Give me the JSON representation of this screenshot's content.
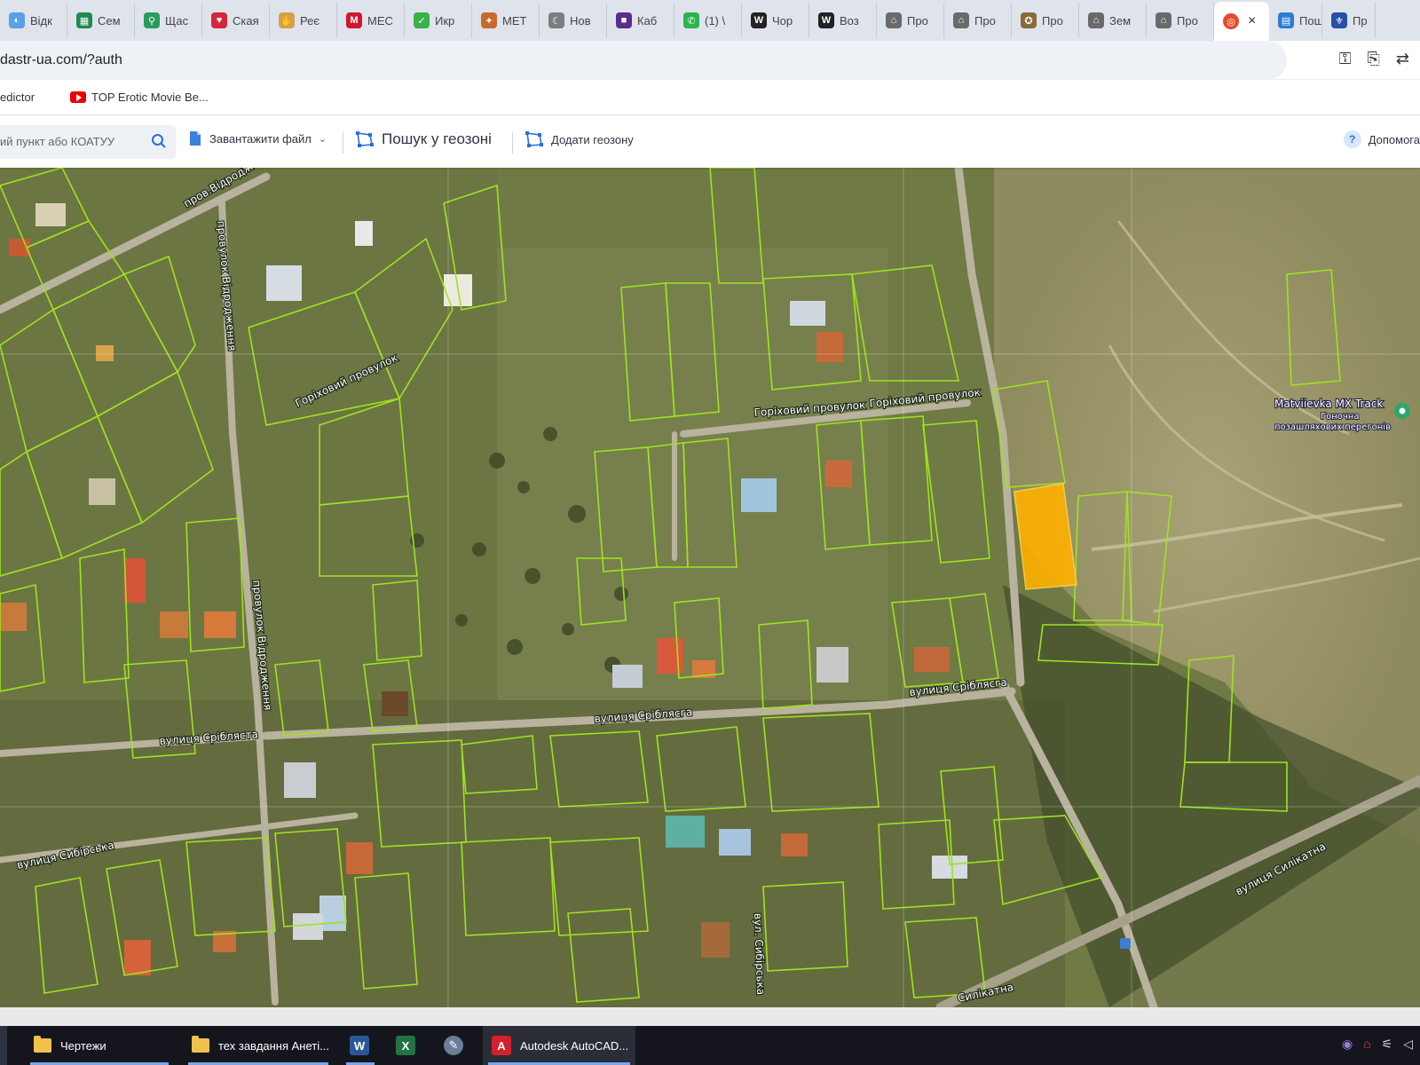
{
  "browser": {
    "tabs": [
      {
        "label": "Відк",
        "icon": "globe-icon",
        "color": "#5aa0e6"
      },
      {
        "label": "Сем",
        "icon": "sheets-icon",
        "color": "#1f8a4c"
      },
      {
        "label": "Щас",
        "icon": "map-pin-icon",
        "color": "#2a9d5b"
      },
      {
        "label": "Ская",
        "icon": "heart-icon",
        "color": "#d6263a"
      },
      {
        "label": "Реє",
        "icon": "hand-icon",
        "color": "#d4a14a"
      },
      {
        "label": "МЕС",
        "icon": "m-icon",
        "color": "#d0162c"
      },
      {
        "label": "Икр",
        "icon": "check-icon",
        "color": "#3cb04a"
      },
      {
        "label": "МЕТ",
        "icon": "compass-icon",
        "color": "#c8692b"
      },
      {
        "label": "Нов",
        "icon": "moon-icon",
        "color": "#7d7d7d"
      },
      {
        "label": "Каб",
        "icon": "square-icon",
        "color": "#5b2d8e"
      },
      {
        "label": "(1) \\",
        "icon": "whatsapp-icon",
        "color": "#2bb24c"
      },
      {
        "label": "Чор",
        "icon": "wikipedia-icon",
        "color": "#222222"
      },
      {
        "label": "Воз",
        "icon": "wikipedia-icon",
        "color": "#222222"
      },
      {
        "label": "Про",
        "icon": "building-icon",
        "color": "#6a6a6a"
      },
      {
        "label": "Про",
        "icon": "building-icon",
        "color": "#6a6a6a"
      },
      {
        "label": "Про",
        "icon": "badge-icon",
        "color": "#8a6a3a"
      },
      {
        "label": "Зем",
        "icon": "building-icon",
        "color": "#6a6a6a"
      },
      {
        "label": "Про",
        "icon": "building-icon",
        "color": "#6a6a6a"
      }
    ],
    "active_tab": {
      "icon": "kadastr-icon",
      "close": "×"
    },
    "after_tabs": [
      {
        "label": "Пош",
        "icon": "doc-icon"
      },
      {
        "label": "Пр",
        "icon": "emblem-icon"
      }
    ],
    "url": "dastr-ua.com/?auth",
    "bookmarks": [
      {
        "label": "edictor",
        "icon": ""
      },
      {
        "label": "TOP Erotic Movie Be...",
        "icon": "youtube-icon"
      }
    ]
  },
  "toolbar": {
    "search_placeholder": "ий пункт або КОАТУУ",
    "upload_label": "Завантажити файл",
    "geozone_search_label": "Пошук у геозоні",
    "add_geozone_label": "Додати геозону",
    "help_label": "Допомога"
  },
  "map": {
    "streets": [
      {
        "name": "пров.Відродж"
      },
      {
        "name": "провулок Відродження"
      },
      {
        "name": "Горіховий провулок"
      },
      {
        "name": "Горіховий провулок"
      },
      {
        "name": "Горіховий провулок"
      },
      {
        "name": "вулиця Сріблясга"
      },
      {
        "name": "вулиця Сріблясга"
      },
      {
        "name": "вулиця Срібляста"
      },
      {
        "name": "провулок Відродження"
      },
      {
        "name": "вулиця Сибірська"
      },
      {
        "name": "вул. Сибірська"
      },
      {
        "name": "вулиця Силікатна"
      },
      {
        "name": "Силікатна"
      }
    ],
    "poi": {
      "name": "Matviievka MX Track",
      "sub1": "Гоночна",
      "sub2": "позашляхових перегонів"
    },
    "colors": {
      "parcel_outline": "#9ee31e",
      "selected_parcel": "#ffb000",
      "road": "#b9b29e"
    }
  },
  "taskbar": {
    "items": [
      {
        "label": "Чертежи",
        "icon": "folder-icon"
      },
      {
        "label": "тех завдання Анеті...",
        "icon": "folder-icon"
      },
      {
        "label": "",
        "icon": "word-icon"
      },
      {
        "label": "",
        "icon": "excel-icon"
      },
      {
        "label": "",
        "icon": "paint-icon"
      },
      {
        "label": "Autodesk AutoCAD...",
        "icon": "autocad-icon"
      }
    ]
  }
}
